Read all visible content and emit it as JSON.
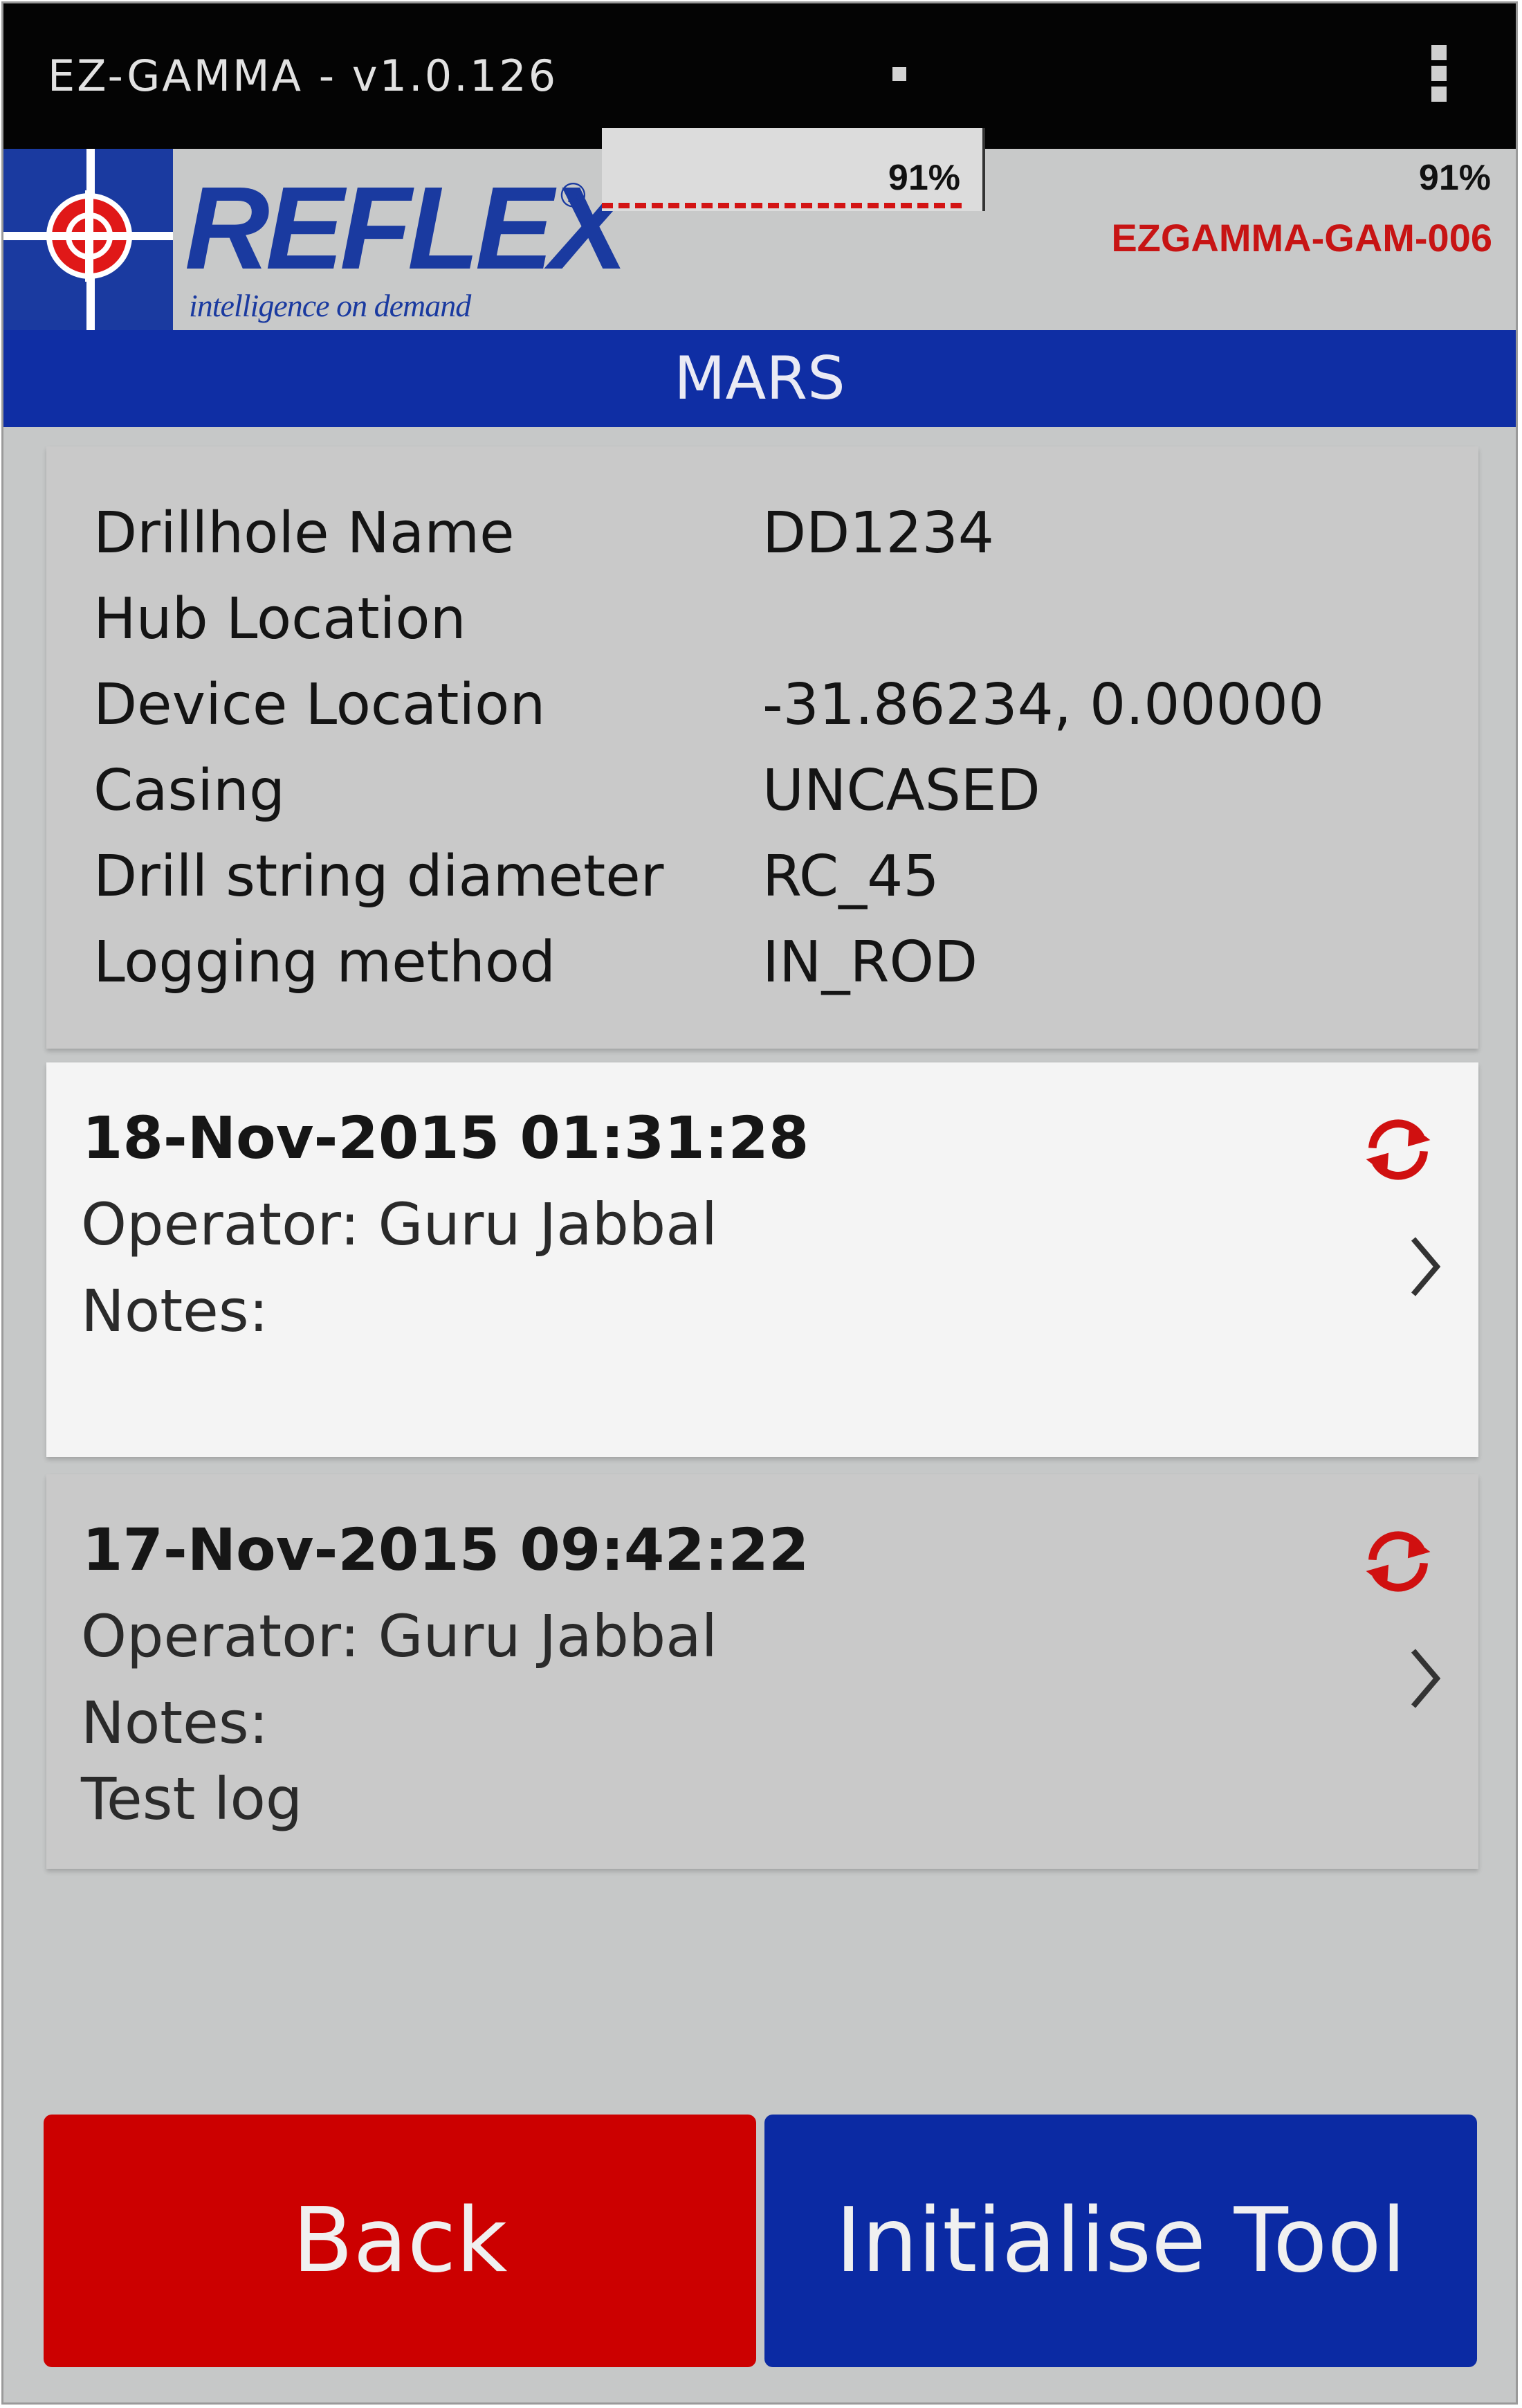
{
  "app": {
    "title": "EZ-GAMMA - v1.0.126"
  },
  "header": {
    "logo_text": "REFLEX",
    "logo_registered": "®",
    "logo_tagline": "intelligence on demand",
    "battery_primary": "91%",
    "battery_secondary": "91%",
    "device_id": "EZGAMMA-GAM-006"
  },
  "project": {
    "name": "MARS"
  },
  "info": {
    "rows": [
      {
        "label": "Drillhole Name",
        "value": "DD1234"
      },
      {
        "label": "Hub Location",
        "value": ""
      },
      {
        "label": "Device Location",
        "value": "-31.86234, 0.00000"
      },
      {
        "label": "Casing",
        "value": "UNCASED"
      },
      {
        "label": "Drill string diameter",
        "value": "RC_45"
      },
      {
        "label": "Logging method",
        "value": "IN_ROD"
      }
    ]
  },
  "logs": [
    {
      "datetime": "18-Nov-2015 01:31:28",
      "operator": "Operator: Guru Jabbal",
      "notes_label": "Notes:",
      "notes": "",
      "selected": true
    },
    {
      "datetime": "17-Nov-2015 09:42:22",
      "operator": "Operator: Guru Jabbal",
      "notes_label": "Notes:",
      "notes": "Test log",
      "selected": false
    }
  ],
  "buttons": {
    "back": "Back",
    "initialise": "Initialise Tool"
  },
  "colors": {
    "brand_blue": "#0f2ea4",
    "back_red": "#cc0000",
    "device_id_red": "#c71414",
    "sync_icon_red": "#d01010"
  },
  "icons": {
    "sync": "sync-icon",
    "chevron": "chevron-right-icon",
    "overflow": "overflow-menu-icon"
  }
}
